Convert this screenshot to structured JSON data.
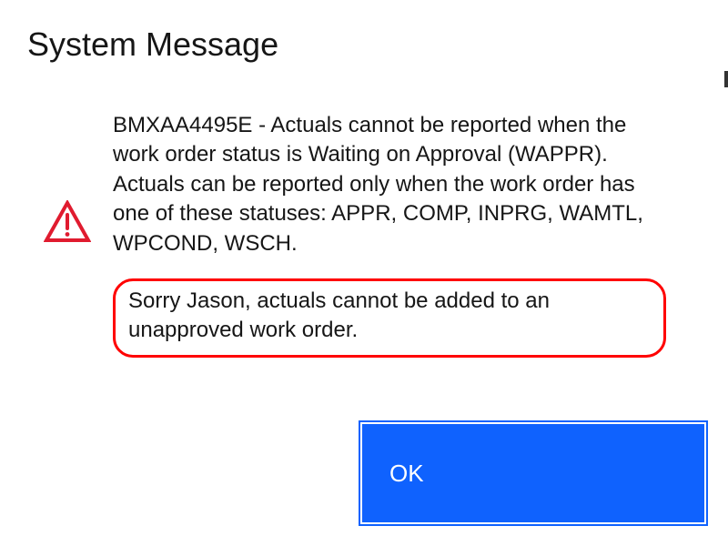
{
  "dialog": {
    "title": "System Message",
    "icon": "warning-icon",
    "message_primary": "BMXAA4495E - Actuals cannot be reported when the work order status is Waiting on Approval (WAPPR). Actuals can be reported only when the work order has one of these statuses: APPR, COMP, INPRG, WAMTL, WPCOND, WSCH.",
    "message_secondary": "Sorry Jason, actuals cannot be added to an unapproved work order.",
    "ok_label": "OK",
    "colors": {
      "accent": "#0f62fe",
      "warning_border": "#e01b2f",
      "highlight_ring": "#ff0000"
    }
  }
}
